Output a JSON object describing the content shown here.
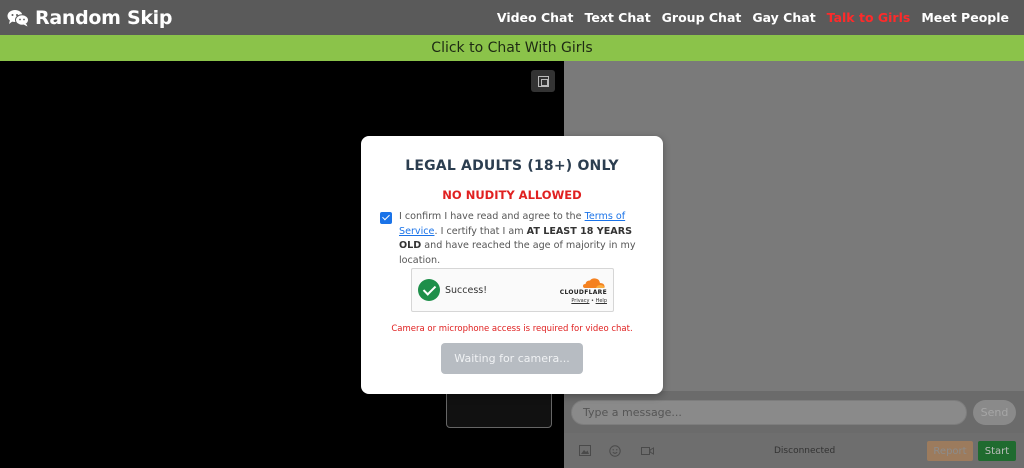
{
  "header": {
    "logo_text": "Random Skip",
    "nav": [
      {
        "label": "Video Chat"
      },
      {
        "label": "Text Chat"
      },
      {
        "label": "Group Chat"
      },
      {
        "label": "Gay Chat"
      },
      {
        "label": "Talk to Girls",
        "highlight": true
      },
      {
        "label": "Meet People"
      }
    ]
  },
  "banner": {
    "text": "Click to Chat With Girls"
  },
  "chat": {
    "input_placeholder": "Type a message...",
    "send_label": "Send",
    "status": "Disconnected",
    "report_label": "Report",
    "start_label": "Start"
  },
  "modal": {
    "title": "LEGAL ADULTS (18+) ONLY",
    "warning": "NO NUDITY ALLOWED",
    "consent_prefix": "I confirm I have read and agree to the",
    "tos_link": "Terms of Service",
    "consent_mid": ". I certify that I am",
    "consent_bold": "AT LEAST 18 YEARS OLD",
    "consent_suffix": "and have reached the age of majority in my location.",
    "checked": true,
    "turnstile": {
      "status": "Success!",
      "brand": "CLOUDFLARE",
      "privacy": "Privacy",
      "sep": "•",
      "help": "Help"
    },
    "camera_warning": "Camera or microphone access is required for video chat.",
    "button_label": "Waiting for camera..."
  },
  "colors": {
    "banner": "#8bc34a",
    "highlight_nav": "#ff2a2a",
    "warning": "#e02020",
    "link": "#1a73e8"
  }
}
